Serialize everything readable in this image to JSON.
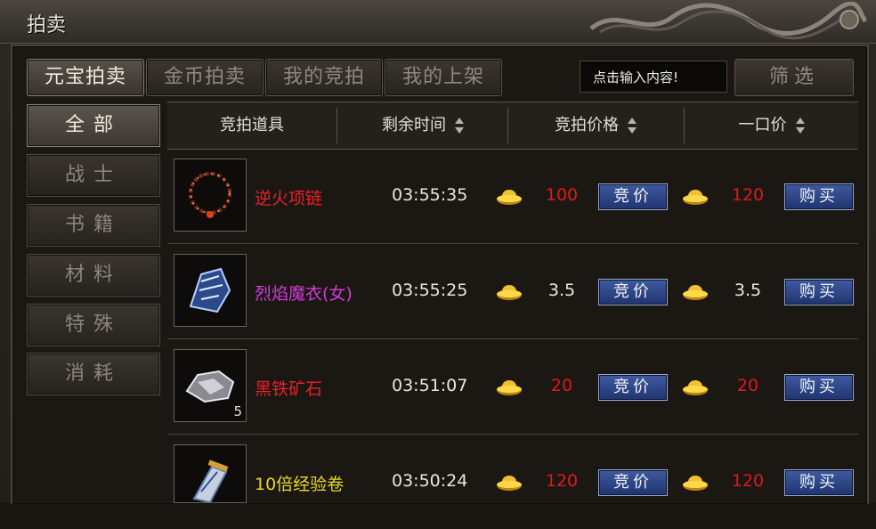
{
  "window": {
    "title": "拍卖"
  },
  "tabs": [
    {
      "label": "元宝拍卖",
      "active": true
    },
    {
      "label": "金币拍卖",
      "active": false
    },
    {
      "label": "我的竞拍",
      "active": false
    },
    {
      "label": "我的上架",
      "active": false
    }
  ],
  "search": {
    "placeholder": "点击输入内容!"
  },
  "filter_label": "筛选",
  "sidebar": {
    "items": [
      {
        "label": "全部",
        "active": true
      },
      {
        "label": "战士",
        "active": false
      },
      {
        "label": "书籍",
        "active": false
      },
      {
        "label": "材料",
        "active": false
      },
      {
        "label": "特殊",
        "active": false
      },
      {
        "label": "消耗",
        "active": false
      }
    ]
  },
  "table": {
    "columns": [
      "竞拍道具",
      "剩余时间",
      "竞拍价格",
      "一口价"
    ],
    "bid_button": "竞价",
    "buy_button": "购买",
    "currency_icon": "gold-ingot-icon",
    "rows": [
      {
        "name": "逆火项链",
        "name_color": "#e8202a",
        "time": "03:55:35",
        "bid_price": "100",
        "buyout": "120",
        "price_color": "#e01818",
        "icon": "necklace-icon",
        "qty": ""
      },
      {
        "name": "烈焰魔衣(女)",
        "name_color": "#d23ad8",
        "time": "03:55:25",
        "bid_price": "3.5",
        "buyout": "3.5",
        "price_color": "#ece6da",
        "icon": "robe-icon",
        "qty": ""
      },
      {
        "name": "黑铁矿石",
        "name_color": "#e8202a",
        "time": "03:51:07",
        "bid_price": "20",
        "buyout": "20",
        "price_color": "#e01818",
        "icon": "ore-icon",
        "qty": "5"
      },
      {
        "name": "10倍经验卷",
        "name_color": "#e8d820",
        "time": "03:50:24",
        "bid_price": "120",
        "buyout": "120",
        "price_color": "#e01818",
        "icon": "scroll-icon",
        "qty": ""
      }
    ]
  }
}
